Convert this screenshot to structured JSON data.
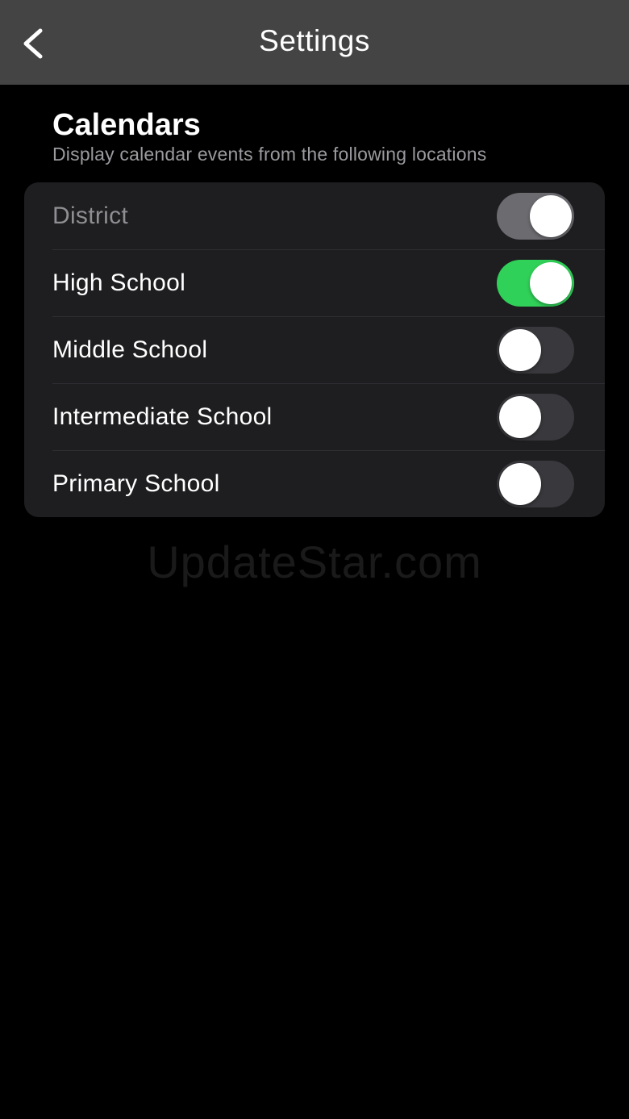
{
  "navbar": {
    "title": "Settings",
    "back_icon": "chevron-left-icon"
  },
  "calendars": {
    "title": "Calendars",
    "subtitle": "Display calendar events from the following locations",
    "items": [
      {
        "label": "District",
        "enabled": true,
        "disabled": true
      },
      {
        "label": "High School",
        "enabled": true,
        "disabled": false
      },
      {
        "label": "Middle School",
        "enabled": false,
        "disabled": false
      },
      {
        "label": "Intermediate School",
        "enabled": false,
        "disabled": false
      },
      {
        "label": "Primary School",
        "enabled": false,
        "disabled": false
      }
    ]
  },
  "watermark": "UpdateStar.com",
  "colors": {
    "toggle_on": "#30d158",
    "toggle_off": "#39393d",
    "toggle_disabled": "#6b6b70",
    "navbar": "#444444",
    "card": "#1e1e20"
  }
}
